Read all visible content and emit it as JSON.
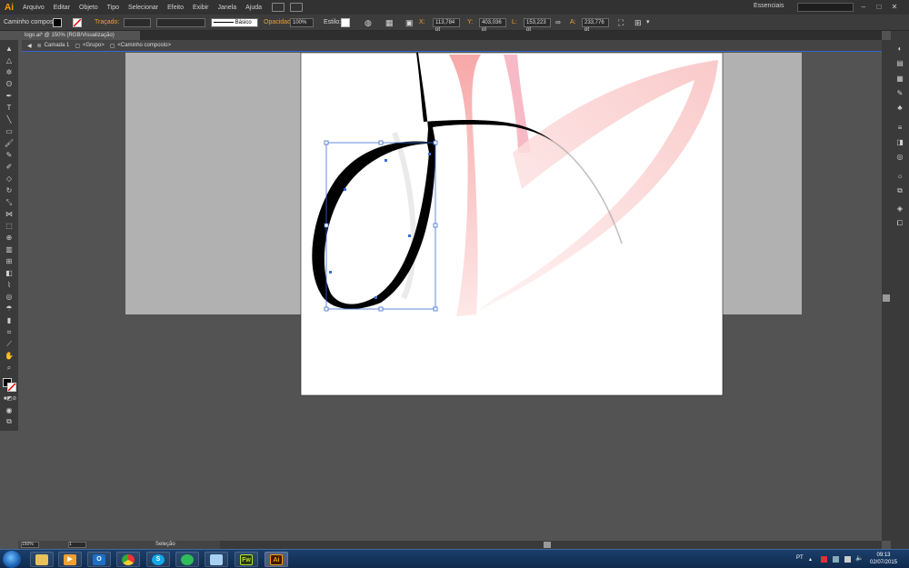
{
  "app": {
    "logo": "Ai",
    "workspace": "Essenciais"
  },
  "menu": [
    "Arquivo",
    "Editar",
    "Objeto",
    "Tipo",
    "Selecionar",
    "Efeito",
    "Exibir",
    "Janela",
    "Ajuda"
  ],
  "control": {
    "object_type": "Caminho composto",
    "stroke_label": "Traçado:",
    "profile": "Básico",
    "opacity_label": "Opacidade:",
    "opacity": "100%",
    "style_label": "Estilo:",
    "x_label": "X:",
    "x": "113,784 pt",
    "y_label": "Y:",
    "y": "403,036 pt",
    "w_label": "L:",
    "w": "153,223 pt",
    "h_label": "A:",
    "h": "233,776 pt"
  },
  "document": {
    "tab": "logo.ai* @ 150% (RGB/Visualização)"
  },
  "breadcrumb": [
    "Camada 1",
    "<Grupo>",
    "<Caminho composto>"
  ],
  "status": {
    "zoom": "150%",
    "page": "1",
    "tool": "Seleção"
  },
  "taskbar": {
    "lang": "PT",
    "time": "09:13",
    "date": "02/07/2015"
  },
  "colors": {
    "accent": "#ff9a00",
    "selection": "#3366cc",
    "artwork_pink": "#f8b8b8"
  }
}
